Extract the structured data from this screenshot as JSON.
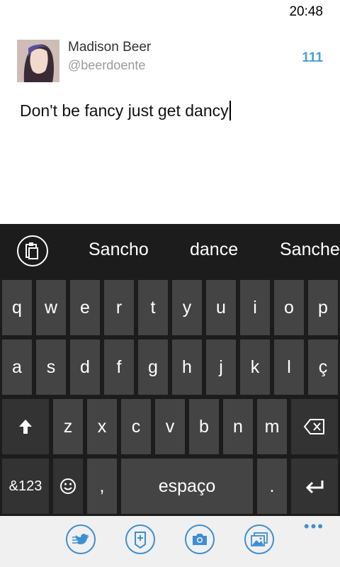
{
  "status": {
    "time": "20:48"
  },
  "account": {
    "name": "Madison Beer",
    "handle": "@beerdoente",
    "remaining_chars": "111"
  },
  "compose": {
    "text": "Don't be fancy just get dancy"
  },
  "keyboard": {
    "suggestions": [
      "Sancho",
      "dance",
      "Sanche"
    ],
    "row1": [
      "q",
      "w",
      "e",
      "r",
      "t",
      "y",
      "u",
      "i",
      "o",
      "p"
    ],
    "row2": [
      "a",
      "s",
      "d",
      "f",
      "g",
      "h",
      "j",
      "k",
      "l",
      "ç"
    ],
    "row3": [
      "z",
      "x",
      "c",
      "v",
      "b",
      "n",
      "m"
    ],
    "row4": {
      "symbols": "&123",
      "comma": ",",
      "space": "espaço",
      "period": "."
    }
  },
  "appbar": {
    "icons": [
      "mention-twitter-icon",
      "add-note-icon",
      "camera-icon",
      "gallery-icon"
    ],
    "more": "•••"
  },
  "colors": {
    "accent": "#3e8fd0",
    "count": "#4a9fd6",
    "key": "#444444",
    "keyboard_bg": "#1c1c1c"
  }
}
